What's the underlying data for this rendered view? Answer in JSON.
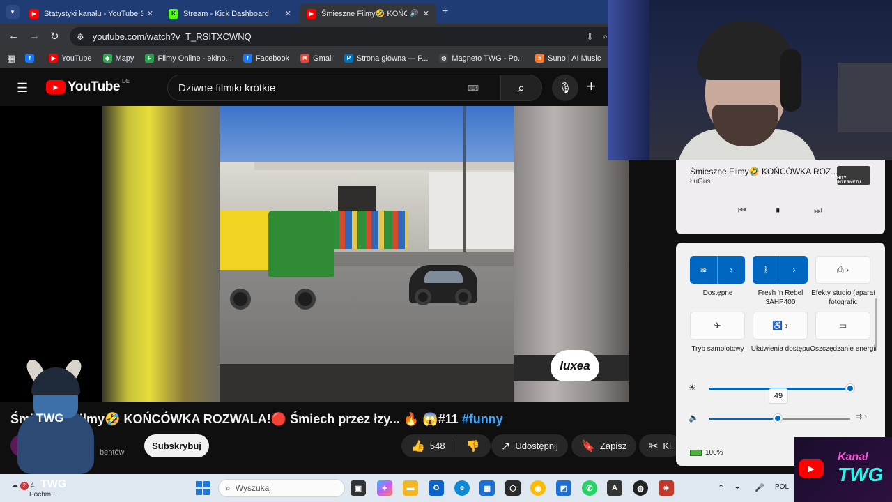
{
  "browser": {
    "tabs": [
      {
        "title": "Statystyki kanału - YouTube Stu",
        "favicon_color": "#ff0000",
        "active": false
      },
      {
        "title": "Stream - Kick Dashboard",
        "favicon_color": "#53fc18",
        "active": false
      },
      {
        "title": "Śmieszne Filmy🤣 KOŃCÓW",
        "favicon_color": "#ff0000",
        "active": true
      }
    ],
    "url": "youtube.com/watch?v=T_RSITXCWNQ",
    "bookmarks": [
      {
        "label": "",
        "icon": "facebook-icon",
        "color": "#1877f2",
        "glyph": "f"
      },
      {
        "label": "YouTube",
        "icon": "youtube-icon",
        "color": "#ff0000",
        "glyph": "▶"
      },
      {
        "label": "Mapy",
        "icon": "maps-icon",
        "color": "#34a853",
        "glyph": "◆"
      },
      {
        "label": "Filmy Online - ekino...",
        "icon": "ekino-icon",
        "color": "#2b9f4a",
        "glyph": "F"
      },
      {
        "label": "Facebook",
        "icon": "facebook-icon",
        "color": "#1877f2",
        "glyph": "f"
      },
      {
        "label": "Gmail",
        "icon": "gmail-icon",
        "color": "#ea4335",
        "glyph": "M"
      },
      {
        "label": "Strona główna — P...",
        "icon": "paypal-icon",
        "color": "#0070ba",
        "glyph": "P"
      },
      {
        "label": "Magneto TWG - Po...",
        "icon": "magneto-icon",
        "color": "#444444",
        "glyph": "◎"
      },
      {
        "label": "Suno | AI Music",
        "icon": "suno-icon",
        "color": "#ff7a2f",
        "glyph": "S"
      }
    ]
  },
  "youtube": {
    "region": "DE",
    "logo_text": "YouTube",
    "search_query": "Dziwne filmiki krótkie",
    "video": {
      "title_prefix": "Śmieszne Filmy🤣 KOŃCÓWKA ROZWALA!🔴 Śmiech przez łzy... 🔥 😱#11 ",
      "title_tag": "#funny",
      "watermark": "luxea",
      "subscribers_text": "bentów",
      "subscribe_label": "Subskrybuj",
      "likes": "548",
      "share_label": "Udostępnij",
      "save_label": "Zapisz",
      "clip_label": "Kl"
    }
  },
  "media_flyout": {
    "title": "Śmieszne Filmy🤣 KOŃCÓWKA ROZ...",
    "artist": "ŁuGus",
    "thumb_text": "HITY INTERNETU"
  },
  "quick_settings": {
    "tiles": [
      {
        "label": "Dostępne",
        "state": "on",
        "icon": "wifi-icon"
      },
      {
        "label": "Fresh 'n Rebel 3AHP400",
        "state": "on",
        "icon": "bluetooth-icon"
      },
      {
        "label": "Efekty studio (aparat fotografic",
        "state": "off",
        "icon": "camera-effects-icon"
      },
      {
        "label": "Tryb samolotowy",
        "state": "off",
        "icon": "airplane-icon"
      },
      {
        "label": "Ułatwienia dostępu",
        "state": "off",
        "icon": "accessibility-icon"
      },
      {
        "label": "Oszczędzanie energii",
        "state": "off",
        "icon": "battery-saver-icon"
      }
    ],
    "brightness": 100,
    "volume": 49,
    "volume_tooltip": "49",
    "battery": "100%"
  },
  "overlay": {
    "channel_line1": "Kanał",
    "channel_line2": "TWG",
    "mascot_text": "TWG",
    "taskbar_mascot_text": "TWG"
  },
  "taskbar": {
    "weather_badge": "2",
    "weather_text": "4",
    "weather_sub": "Pochm...",
    "search_placeholder": "Wyszukaj",
    "language": "POL"
  }
}
